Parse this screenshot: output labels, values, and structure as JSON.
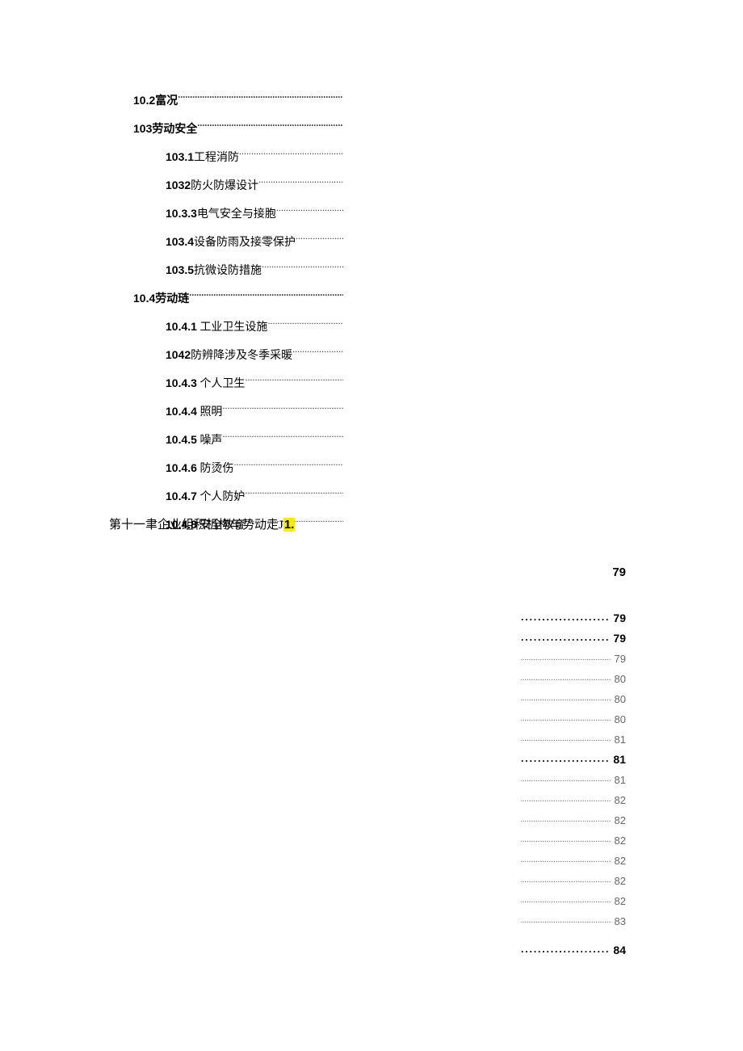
{
  "toc_top": [
    {
      "indent": 1,
      "bold": true,
      "num": "10.2",
      "text": "富况"
    },
    {
      "indent": 1,
      "bold": true,
      "num": "103",
      "text": "劳动安全"
    },
    {
      "indent": 2,
      "bold": false,
      "num": "103.1",
      "text": "工程消防"
    },
    {
      "indent": 2,
      "bold": false,
      "num": "1032",
      "text": "防火防爆设计"
    },
    {
      "indent": 2,
      "bold": false,
      "num": "10.3.3",
      "text": "电气安全与接胞"
    },
    {
      "indent": 2,
      "bold": false,
      "num": "103.4",
      "text": "设备防雨及接零保护"
    },
    {
      "indent": 2,
      "bold": false,
      "num": "103.5",
      "text": "抗微设防措施"
    },
    {
      "indent": 1,
      "bold": true,
      "num": "10.4",
      "text": "劳动琏"
    },
    {
      "indent": 2,
      "bold": false,
      "num": "10.4.1",
      "text": "工业卫生设施"
    },
    {
      "indent": 2,
      "bold": false,
      "num": "1042",
      "text": "防辨降涉及冬季采暖"
    },
    {
      "indent": 2,
      "bold": false,
      "num": "10.4.3",
      "text": "个人卫生"
    },
    {
      "indent": 2,
      "bold": false,
      "num": "10.4.4",
      "text": "照明"
    },
    {
      "indent": 2,
      "bold": false,
      "num": "10.4.5",
      "text": "噪声"
    },
    {
      "indent": 2,
      "bold": false,
      "num": "10.4.6",
      "text": "防烫伤"
    },
    {
      "indent": 2,
      "bold": false,
      "num": "10.4.7",
      "text": "个人防妒"
    },
    {
      "indent": 2,
      "bold": false,
      "num": "10.4.8",
      "text": "安全教育"
    }
  ],
  "chapter_line": {
    "prefix": "第十一聿企业组积机构与势动走J",
    "highlight": "1."
  },
  "topright_page": "79",
  "right_pages": [
    {
      "bold": true,
      "page": "79"
    },
    {
      "bold": true,
      "page": "79"
    },
    {
      "bold": false,
      "page": "79"
    },
    {
      "bold": false,
      "page": "80"
    },
    {
      "bold": false,
      "page": "80"
    },
    {
      "bold": false,
      "page": "80"
    },
    {
      "bold": false,
      "page": "81"
    },
    {
      "bold": true,
      "page": "81"
    },
    {
      "bold": false,
      "page": "81"
    },
    {
      "bold": false,
      "page": "82"
    },
    {
      "bold": false,
      "page": "82"
    },
    {
      "bold": false,
      "page": "82"
    },
    {
      "bold": false,
      "page": "82"
    },
    {
      "bold": false,
      "page": "82"
    },
    {
      "bold": false,
      "page": "82"
    },
    {
      "bold": false,
      "page": "83"
    },
    {
      "bold": true,
      "page": "84",
      "gap": true
    }
  ]
}
